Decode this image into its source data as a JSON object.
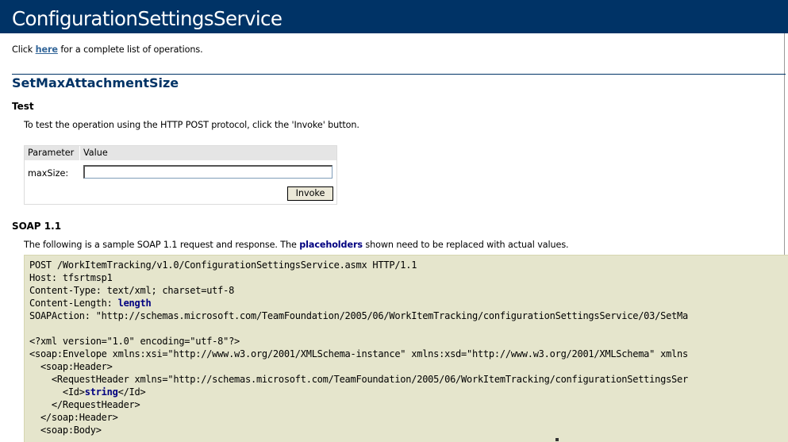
{
  "header": {
    "title": "ConfigurationSettingsService"
  },
  "intro": {
    "before": "Click ",
    "link": "here",
    "after": " for a complete list of operations."
  },
  "operation": {
    "name": "SetMaxAttachmentSize"
  },
  "test": {
    "heading": "Test",
    "description": "To test the operation using the HTTP POST protocol, click the 'Invoke' button.",
    "table": {
      "col_parameter": "Parameter",
      "col_value": "Value",
      "param_label": "maxSize:",
      "param_value": "",
      "invoke_label": "Invoke"
    }
  },
  "soap": {
    "heading": "SOAP 1.1",
    "desc_before": "The following is a sample SOAP 1.1 request and response. The ",
    "desc_placeholder": "placeholders",
    "desc_after": " shown need to be replaced with actual values.",
    "lines": [
      {
        "pre": "POST /WorkItemTracking/v1.0/ConfigurationSettingsService.asmx HTTP/1.1",
        "ph": "",
        "post": ""
      },
      {
        "pre": "Host: tfsrtmsp1",
        "ph": "",
        "post": ""
      },
      {
        "pre": "Content-Type: text/xml; charset=utf-8",
        "ph": "",
        "post": ""
      },
      {
        "pre": "Content-Length: ",
        "ph": "length",
        "post": ""
      },
      {
        "pre": "SOAPAction: \"http://schemas.microsoft.com/TeamFoundation/2005/06/WorkItemTracking/configurationSettingsService/03/SetMa",
        "ph": "",
        "post": ""
      },
      {
        "pre": "",
        "ph": "",
        "post": ""
      },
      {
        "pre": "<?xml version=\"1.0\" encoding=\"utf-8\"?>",
        "ph": "",
        "post": ""
      },
      {
        "pre": "<soap:Envelope xmlns:xsi=\"http://www.w3.org/2001/XMLSchema-instance\" xmlns:xsd=\"http://www.w3.org/2001/XMLSchema\" xmlns",
        "ph": "",
        "post": ""
      },
      {
        "pre": "  <soap:Header>",
        "ph": "",
        "post": ""
      },
      {
        "pre": "    <RequestHeader xmlns=\"http://schemas.microsoft.com/TeamFoundation/2005/06/WorkItemTracking/configurationSettingsSer",
        "ph": "",
        "post": ""
      },
      {
        "pre": "      <Id>",
        "ph": "string",
        "post": "</Id>"
      },
      {
        "pre": "    </RequestHeader>",
        "ph": "",
        "post": ""
      },
      {
        "pre": "  </soap:Header>",
        "ph": "",
        "post": ""
      },
      {
        "pre": "  <soap:Body>",
        "ph": "",
        "post": ""
      }
    ]
  }
}
